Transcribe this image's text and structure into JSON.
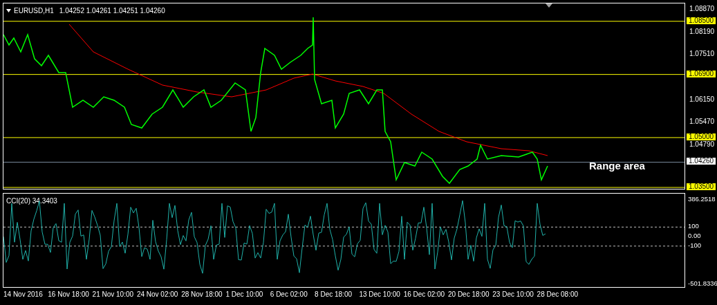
{
  "chart": {
    "symbol": "EURUSD,H1",
    "quotes": "1.04252 1.04261 1.04251 1.04260",
    "price_axis": [
      "1.08870",
      "1.08190",
      "1.07510",
      "1.06150",
      "1.05470",
      "1.04790"
    ],
    "levels": [
      {
        "label": "1.08500",
        "kind": "line"
      },
      {
        "label": "1.06900",
        "kind": "line"
      },
      {
        "label": "1.05000",
        "kind": "line"
      },
      {
        "label": "1.04260",
        "kind": "bid"
      },
      {
        "label": "1.03500",
        "kind": "line"
      }
    ],
    "annotation": "Range area"
  },
  "indicator": {
    "title": "CCI(20) 34.3403",
    "axis": [
      "386.2518",
      "100",
      "0.00",
      "-100",
      "-501.8336"
    ]
  },
  "time_axis": [
    "14 Nov 2016",
    "16 Nov 18:00",
    "21 Nov 10:00",
    "24 Nov 02:00",
    "28 Nov 18:00",
    "1 Dec 10:00",
    "6 Dec 02:00",
    "8 Dec 18:00",
    "13 Dec 10:00",
    "16 Dec 02:00",
    "20 Dec 18:00",
    "23 Dec 10:00",
    "28 Dec 08:00"
  ]
}
